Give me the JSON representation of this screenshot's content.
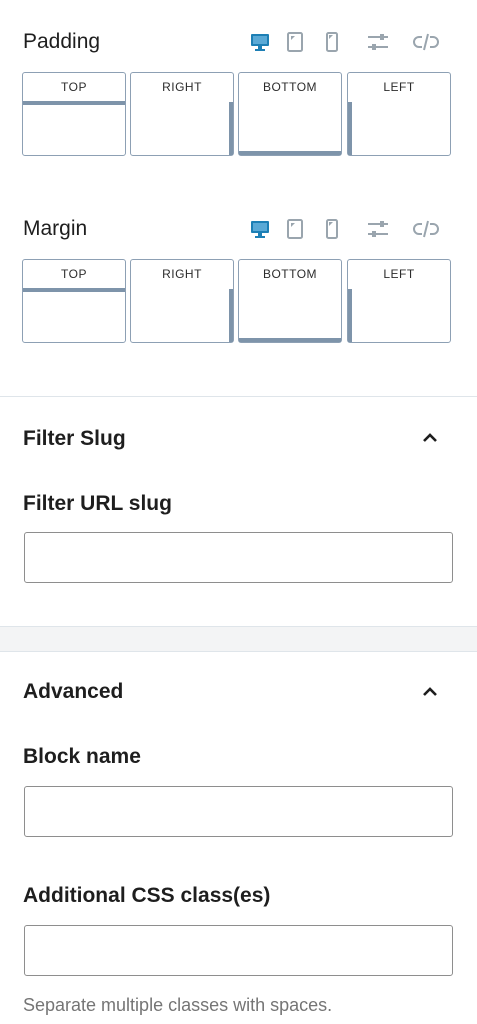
{
  "colors": {
    "accent": "#1d7fb5",
    "icon_gray": "#9aa5ae",
    "box_border": "#8da0b4",
    "box_mark": "#7e94aa"
  },
  "padding": {
    "title": "Padding",
    "icons": [
      "desktop-icon",
      "tablet-icon",
      "mobile-icon",
      "sliders-icon",
      "unlink-icon"
    ],
    "sides": {
      "top": "TOP",
      "right": "RIGHT",
      "bottom": "BOTTOM",
      "left": "LEFT"
    }
  },
  "margin": {
    "title": "Margin",
    "icons": [
      "desktop-icon",
      "tablet-icon",
      "mobile-icon",
      "sliders-icon",
      "unlink-icon"
    ],
    "sides": {
      "top": "TOP",
      "right": "RIGHT",
      "bottom": "BOTTOM",
      "left": "LEFT"
    }
  },
  "filter_slug": {
    "title": "Filter Slug",
    "field_label": "Filter URL slug",
    "value": ""
  },
  "advanced": {
    "title": "Advanced",
    "block_name_label": "Block name",
    "block_name_value": "",
    "css_label": "Additional CSS class(es)",
    "css_value": "",
    "css_help": "Separate multiple classes with spaces."
  }
}
